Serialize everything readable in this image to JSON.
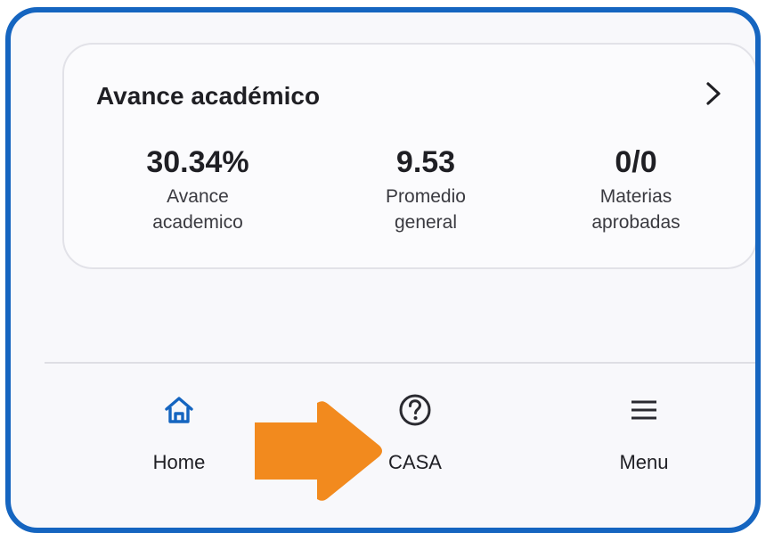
{
  "card": {
    "title": "Avance académico",
    "chevron_icon": "chevron-right-icon",
    "metrics": [
      {
        "value": "30.34%",
        "label": "Avance\nacademico"
      },
      {
        "value": "9.53",
        "label": "Promedio\ngeneral"
      },
      {
        "value": "0/0",
        "label": "Materias\naprobadas"
      }
    ]
  },
  "bottom_nav": {
    "items": [
      {
        "label": "Home",
        "icon": "home-icon",
        "active": true
      },
      {
        "label": "CASA",
        "icon": "help-circle-icon",
        "active": false
      },
      {
        "label": "Menu",
        "icon": "menu-icon",
        "active": false
      }
    ]
  },
  "annotation": {
    "icon": "arrow-right-icon"
  },
  "colors": {
    "frame_border": "#1565c0",
    "active_icon": "#1565c0",
    "annotation_arrow": "#f28a1e"
  }
}
